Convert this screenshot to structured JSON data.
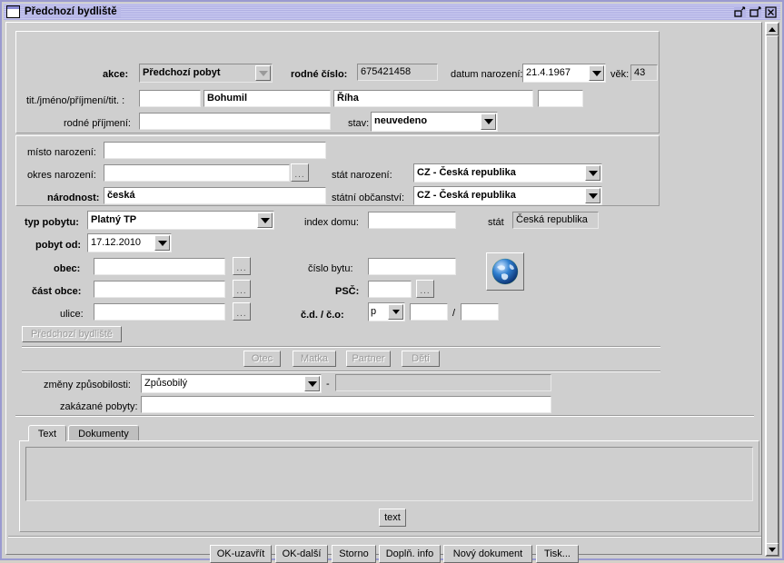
{
  "window": {
    "title": "Předchozí bydliště",
    "buttons": [
      {
        "name": "minimize",
        "glyph": "restore-down-icon"
      },
      {
        "name": "maximize",
        "glyph": "maximize-icon"
      },
      {
        "name": "close",
        "glyph": "close-icon"
      }
    ]
  },
  "form": {
    "akce": {
      "label": "akce:",
      "value": "Předchozí pobyt"
    },
    "rodne_cislo": {
      "label": "rodné číslo:",
      "value": "675421458"
    },
    "datum_narozeni": {
      "label": "datum narození:",
      "value": "21.4.1967"
    },
    "vek": {
      "label": "věk:",
      "value": "43"
    },
    "jmeno_row": {
      "label": "tit./jméno/příjmení/tit. :",
      "titul_pred": "",
      "jmeno": "Bohumil",
      "prijmeni": "Říha",
      "titul_za": ""
    },
    "rodne_prijmeni": {
      "label": "rodné příjmení:",
      "value": ""
    },
    "stav": {
      "label": "stav:",
      "value": "neuvedeno"
    },
    "misto_narozeni": {
      "label": "místo narození:",
      "value": ""
    },
    "okres_narozeni": {
      "label": "okres narození:",
      "value": "",
      "browse": "..."
    },
    "narodnost": {
      "label": "národnost:",
      "value": "česká"
    },
    "stat_narozeni": {
      "label": "stát narození:",
      "value": "CZ - Česká republika"
    },
    "statni_obcanstvi": {
      "label": "státní občanství:",
      "value": "CZ - Česká republika"
    },
    "typ_pobytu": {
      "label": "typ pobytu:",
      "value": "Platný TP"
    },
    "pobyt_od": {
      "label": "pobyt od:",
      "value": "17.12.2010"
    },
    "obec": {
      "label": "obec:",
      "value": "",
      "browse": "..."
    },
    "cast_obce": {
      "label": "část obce:",
      "value": "",
      "browse": "..."
    },
    "ulice": {
      "label": "ulice:",
      "value": "",
      "browse": "..."
    },
    "index_domu": {
      "label": "index domu:",
      "value": ""
    },
    "stat": {
      "label": "stát",
      "value": "Česká republika"
    },
    "cislo_bytu": {
      "label": "číslo bytu:",
      "value": ""
    },
    "psc": {
      "label": "PSČ:",
      "value": "",
      "browse": "..."
    },
    "cd_co": {
      "label": "č.d. / č.o:",
      "type": "p",
      "cislo_domu": "",
      "separator": "/",
      "cislo_orientacni": ""
    },
    "globe_button": "globe-icon",
    "predchozi_bydliste_button": "Předchozí bydliště",
    "relations": [
      "Otec",
      "Matka",
      "Partner",
      "Děti"
    ],
    "zmeny_zpusobilosti": {
      "label": "změny způsobilosti:",
      "value": "Způsobilý",
      "dash": "-",
      "detail": ""
    },
    "zakazane_pobyty": {
      "label": "zakázané pobyty:",
      "value": ""
    }
  },
  "tabs": {
    "items": [
      {
        "label": "Text",
        "selected": true
      },
      {
        "label": "Dokumenty",
        "selected": false
      }
    ],
    "text_content": "",
    "text_button": "text"
  },
  "footer": {
    "buttons": [
      "OK-uzavřít",
      "OK-další",
      "Storno",
      "Doplň. info",
      "Nový dokument",
      "Tisk..."
    ]
  }
}
